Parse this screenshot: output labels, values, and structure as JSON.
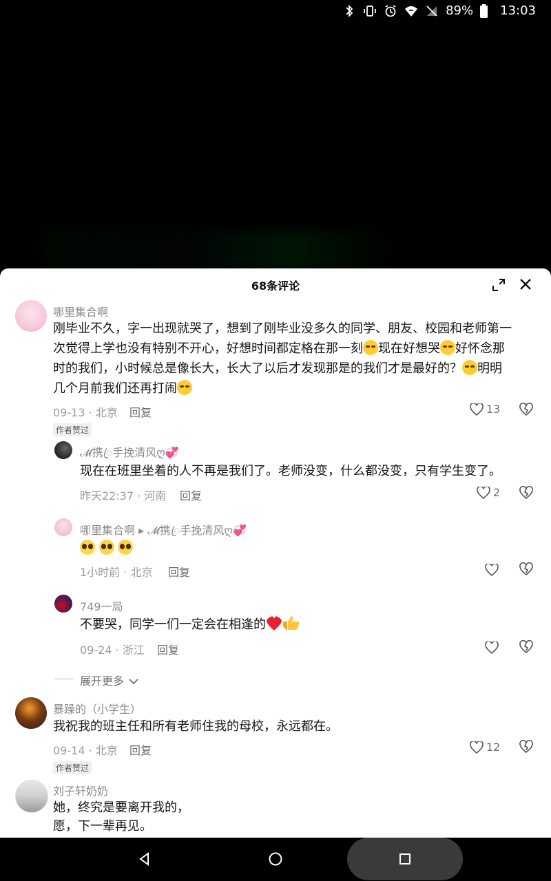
{
  "status_bar": {
    "battery": "89%",
    "time": "13:03"
  },
  "sheet": {
    "title": "68条评论"
  },
  "comments": [
    {
      "username": "哪里集合啊",
      "lines": [
        "刚毕业不久，字一出现就哭了，想到了刚毕业没多久的同学、朋友、校园和老师第一",
        "次觉得上学也没有特别不开心，好想时间都定格在那一刻",
        "现在好想哭",
        "好怀念那",
        "时的我们，小时候总是像长大，长大了以后才发现那是的我们才是最好的？",
        "明明",
        "几个月前我们还再打闹"
      ],
      "meta": "09-13 · 北京",
      "reply": "回复",
      "likes": "13",
      "badge": "作者赞过"
    },
    {
      "username": "𝓜携ꦿ手挽清风ღ💞",
      "content": "现在在班里坐着的人不再是我们了。老师没变，什么都没变，只有学生变了。",
      "meta": "昨天22:37 · 河南",
      "reply": "回复",
      "likes": "2"
    },
    {
      "username": "哪里集合啊 ▸ 𝓜携ꦿ手挽清风ღ💞",
      "meta": "1小时前 · 北京",
      "reply": "回复"
    },
    {
      "username": "749一局",
      "content": "不要哭，同学一们一定会在相逢的",
      "meta": "09-24 · 浙江",
      "reply": "回复"
    },
    {
      "username": "暴躁的（小学生）",
      "content": "我祝我的班主任和所有老师住我的母校，永远都在。",
      "meta": "09-14 · 北京",
      "reply": "回复",
      "likes": "12",
      "badge": "作者赞过"
    },
    {
      "username": "刘子轩奶奶",
      "lines": [
        "她，终究是要离开我的，",
        "愿，下一辈再见。"
      ]
    }
  ],
  "expand_more": "展开更多",
  "icons": {
    "expand": "expand-icon",
    "close": "close-icon",
    "like": "heart-outline-icon",
    "dislike": "broken-heart-icon",
    "back": "back-triangle-icon",
    "home": "home-circle-icon",
    "recent": "recent-square-icon"
  }
}
